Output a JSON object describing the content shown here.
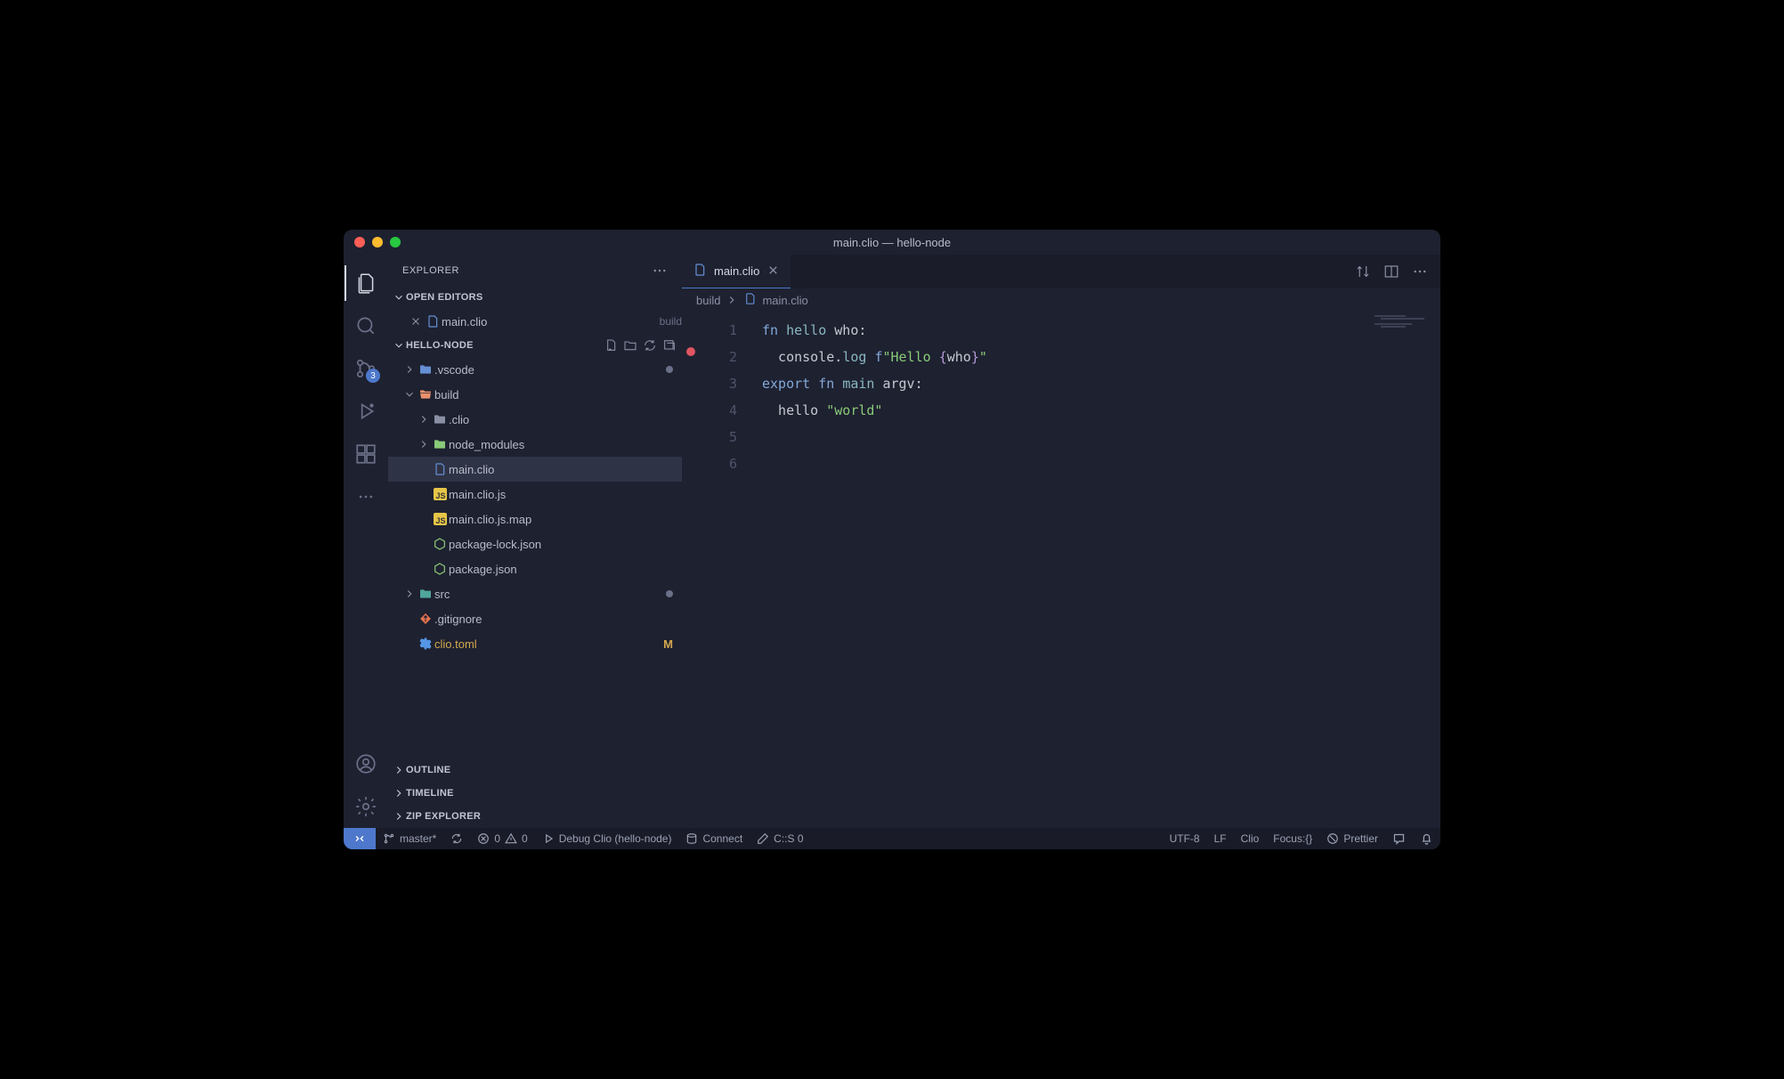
{
  "window": {
    "title": "main.clio — hello-node"
  },
  "activity_bar": {
    "scm_badge": "3"
  },
  "sidebar": {
    "title": "EXPLORER",
    "open_editors": {
      "label": "OPEN EDITORS",
      "items": [
        {
          "name": "main.clio",
          "dir": "build"
        }
      ]
    },
    "workspace": {
      "name": "HELLO-NODE",
      "tree": {
        "vscode": ".vscode",
        "build": "build",
        "clio_dir": ".clio",
        "node_modules": "node_modules",
        "main_clio": "main.clio",
        "main_clio_js": "main.clio.js",
        "main_clio_js_map": "main.clio.js.map",
        "package_lock": "package-lock.json",
        "package_json": "package.json",
        "src": "src",
        "gitignore": ".gitignore",
        "clio_toml": "clio.toml",
        "clio_toml_badge": "M"
      }
    },
    "outline": "OUTLINE",
    "timeline": "TIMELINE",
    "zip_explorer": "ZIP EXPLORER"
  },
  "editor": {
    "tab": {
      "name": "main.clio"
    },
    "breadcrumbs": {
      "folder": "build",
      "file": "main.clio"
    },
    "lines": [
      "1",
      "2",
      "3",
      "4",
      "5",
      "6"
    ],
    "code": {
      "l1": {
        "a": "fn ",
        "b": "hello ",
        "c": "who",
        "d": ":"
      },
      "l2": {
        "a": "  console",
        "b": ".",
        "c": "log ",
        "d": "f",
        "e": "\"Hello ",
        "f": "{",
        "g": "who",
        "h": "}",
        "i": "\""
      },
      "l3": "",
      "l4": {
        "a": "export ",
        "b": "fn ",
        "c": "main ",
        "d": "argv",
        "e": ":"
      },
      "l5": {
        "a": "  hello ",
        "b": "\"world\""
      },
      "l6": ""
    }
  },
  "status_bar": {
    "branch": "master*",
    "errors": "0",
    "warnings": "0",
    "debug": "Debug Clio (hello-node)",
    "connect": "Connect",
    "cs": "C::S 0",
    "encoding": "UTF-8",
    "eol": "LF",
    "lang": "Clio",
    "focus": "Focus:{}",
    "prettier": "Prettier"
  }
}
